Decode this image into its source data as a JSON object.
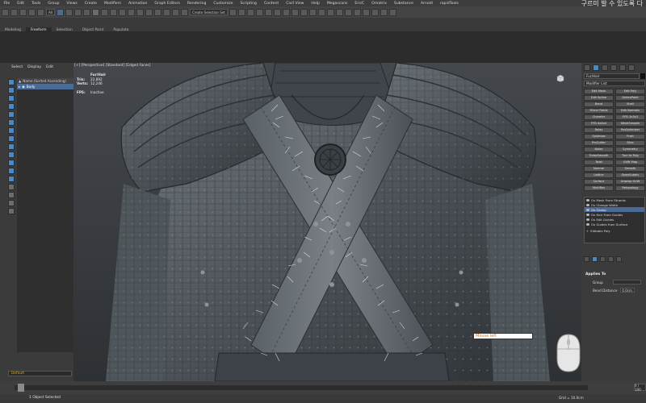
{
  "menubar": {
    "items": [
      "File",
      "Edit",
      "Tools",
      "Group",
      "Views",
      "Create",
      "Modifiers",
      "Animation",
      "Graph Editors",
      "Rendering",
      "Customize",
      "Scripting",
      "Content",
      "Civil View",
      "Help",
      "Megascans",
      "ErisC",
      "Ornatrix",
      "Substance",
      "Arnold",
      "rapidTools"
    ],
    "overlay_text": "구르미 발 수 있도록 다"
  },
  "toolbar": {
    "selection_filter": "All",
    "named_selection": "Create Selection Set"
  },
  "ribbon": {
    "tabs": [
      "Modeling",
      "Freeform",
      "Selection",
      "Object Paint",
      "Populate"
    ],
    "active_tab": "Freeform"
  },
  "scene_explorer": {
    "menu": [
      "Select",
      "Display",
      "Edit"
    ],
    "column_header": "Name (Sorted Ascending)",
    "rows": [
      "Body"
    ],
    "layer": "Default"
  },
  "viewport": {
    "label": "[+] [Perspective] [Standard] [Edged Faces]",
    "stats": {
      "object": "Fur/Hair",
      "polys_label": "Tris:",
      "polys_value": "22,892",
      "verts_label": "Verts:",
      "verts_value": "12,246",
      "fps_label": "FPS:",
      "fps_value": "Inactive"
    },
    "mouse_overlay": "Mouse left"
  },
  "command_panel": {
    "object_name": "Fur/Hair",
    "object_color": "#111111",
    "modifier_list": "Modifier List",
    "modifier_buttons": [
      "Edit Mesh",
      "Edit Poly",
      "Edit Spline",
      "VertexPaint",
      "Bend",
      "Shell",
      "Mirror Fields",
      "Edit Normals",
      "Chamfer",
      "FFD 3x3x3",
      "FFD 4x4x4",
      "MeshSmooth",
      "Relax",
      "ProOptimizer",
      "Optimize",
      "Push",
      "ProCutter",
      "Slice",
      "Noise",
      "Symmetry",
      "TurboSmooth",
      "Turn to Poly",
      "Twist",
      "UVW Map",
      "Normal",
      "Smooth",
      "Lattice",
      "OpenSubdiv",
      "Surface",
      "Unwrap UVW",
      "MultiRes",
      "Retopology"
    ],
    "stack": [
      {
        "label": "Ox Mesh From Strands",
        "selected": false
      },
      {
        "label": "Ox Change Width",
        "selected": false
      },
      {
        "label": "Ox Clump",
        "selected": true
      },
      {
        "label": "Ox Hair From Guides",
        "selected": false
      },
      {
        "label": "Ox Edit Guides",
        "selected": false
      },
      {
        "label": "Ox Guides from Surface",
        "selected": false
      },
      {
        "label": "Editable Poly",
        "selected": false
      }
    ],
    "applies_to": "Applies To",
    "group_label": "Group",
    "bend_label": "Bend Distance",
    "bend_value": "0.0cm"
  },
  "status": {
    "message": "1 Object Selected",
    "grid": "Grid = 10.0cm",
    "frame": "0 / 100"
  },
  "accent": "#4a88c8"
}
